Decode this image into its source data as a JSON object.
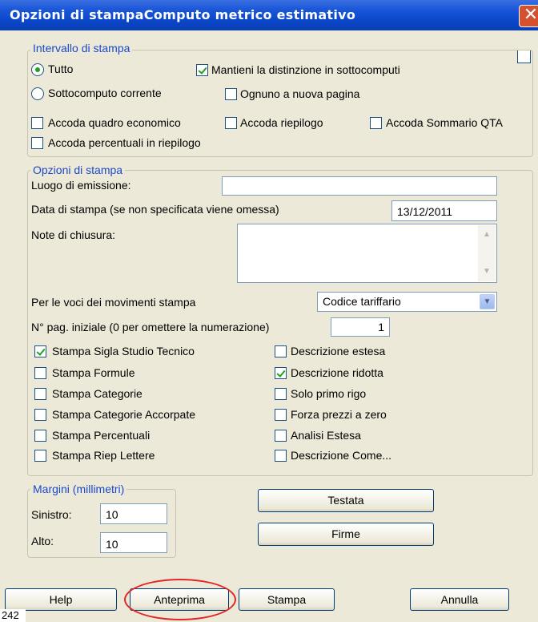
{
  "window": {
    "title": "Opzioni di stampaComputo metrico estimativo",
    "close_glyph": "✕"
  },
  "intervallo": {
    "legend": "Intervallo di stampa",
    "tutto": "Tutto",
    "sottocomputo": "Sottocomputo corrente",
    "mantieni": "Mantieni la distinzione in sottocomputi",
    "ognuno": "Ognuno a nuova pagina",
    "quadro": "Accoda quadro economico",
    "riepilogo": "Accoda riepilogo",
    "sommario": "Accoda Sommario QTA",
    "percentuali": "Accoda percentuali in riepilogo",
    "selected": "Tutto",
    "mantieni_checked": true
  },
  "opzioni": {
    "legend": "Opzioni di stampa",
    "luogo_label": "Luogo di emissione:",
    "luogo_value": "",
    "data_label": "Data di stampa (se non specificata viene omessa)",
    "data_value": "13/12/2011",
    "note_label": "Note di chiusura:",
    "note_value": "",
    "movimenti_label": "Per le voci dei movimenti stampa",
    "movimenti_value": "Codice tariffario",
    "pag_label": "N° pag. iniziale (0 per omettere la numerazione)",
    "pag_value": "1",
    "left_checks": [
      {
        "label": "Stampa Sigla Studio Tecnico",
        "checked": true
      },
      {
        "label": "Stampa Formule",
        "checked": false
      },
      {
        "label": "Stampa Categorie",
        "checked": false
      },
      {
        "label": "Stampa Categorie Accorpate",
        "checked": false
      },
      {
        "label": "Stampa Percentuali",
        "checked": false
      },
      {
        "label": "Stampa Riep Lettere",
        "checked": false
      }
    ],
    "right_checks": [
      {
        "label": "Descrizione estesa",
        "checked": false
      },
      {
        "label": "Descrizione ridotta",
        "checked": true
      },
      {
        "label": "Solo primo rigo",
        "checked": false
      },
      {
        "label": "Forza prezzi a zero",
        "checked": false
      },
      {
        "label": "Analisi Estesa",
        "checked": false
      },
      {
        "label": "Descrizione Come...",
        "checked": false
      }
    ]
  },
  "margini": {
    "legend": "Margini (millimetri)",
    "sinistro_label": "Sinistro:",
    "sinistro_value": "10",
    "alto_label": "Alto:",
    "alto_value": "10"
  },
  "buttons": {
    "testata": "Testata",
    "firme": "Firme",
    "help": "Help",
    "anteprima": "Anteprima",
    "stampa": "Stampa",
    "annulla": "Annulla"
  },
  "page_number": "242",
  "colors": {
    "legend": "#1a49c8",
    "check": "#21a121",
    "annotation": "#e32626"
  }
}
